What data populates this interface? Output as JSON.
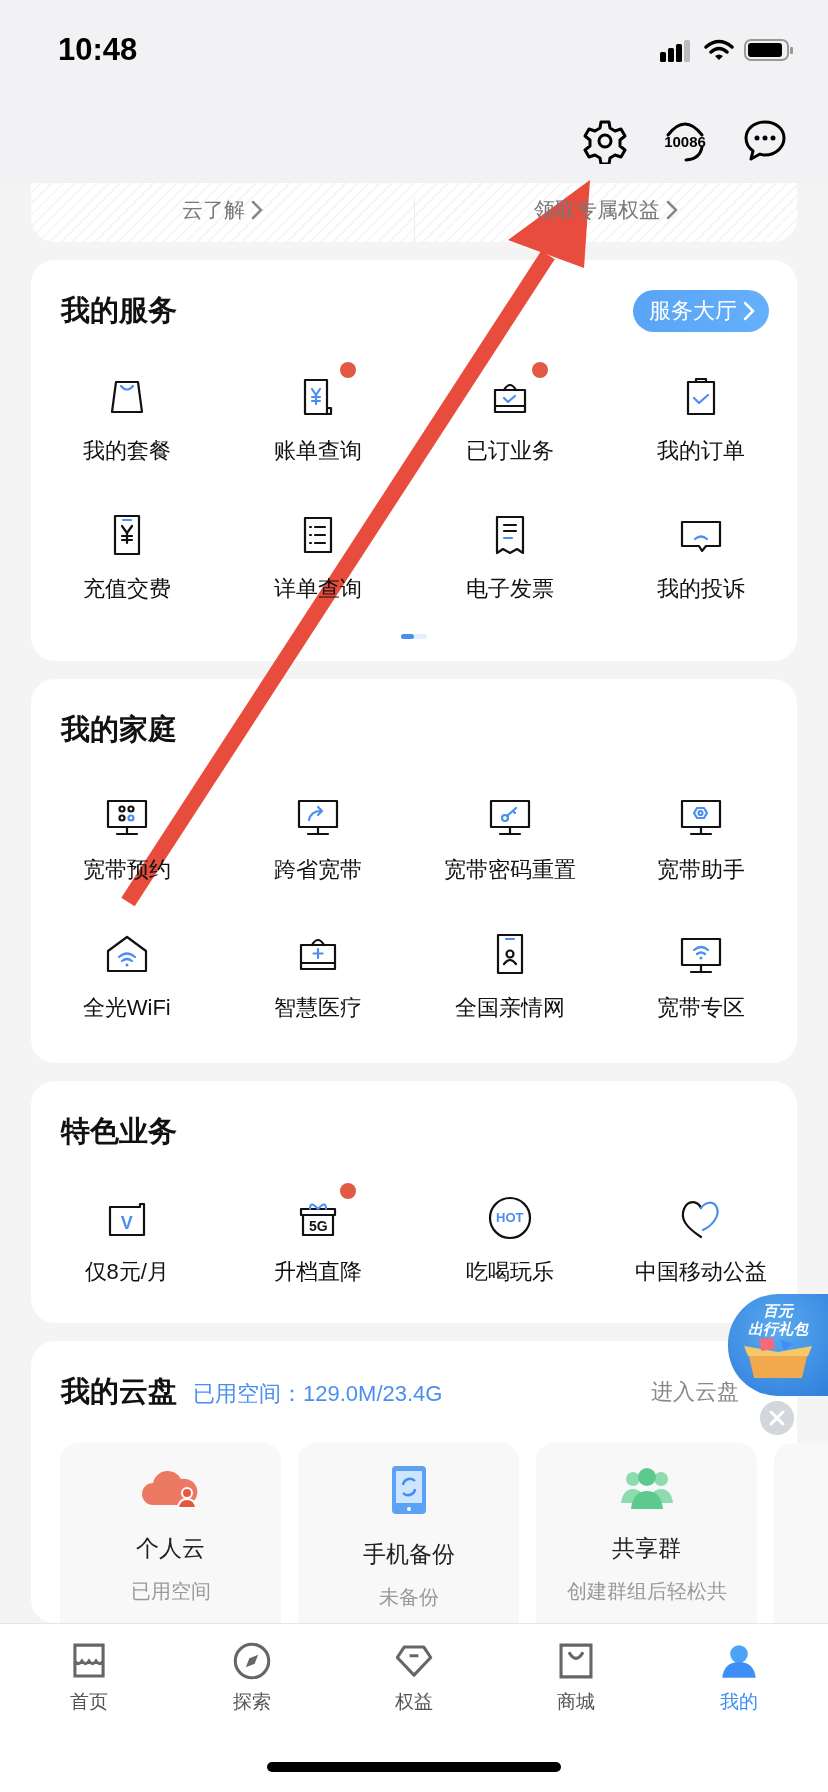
{
  "status_bar": {
    "time": "10:48"
  },
  "header": {
    "support_label": "10086"
  },
  "banner": {
    "items": [
      "云了解",
      "领取专属权益"
    ]
  },
  "services": {
    "title": "我的服务",
    "hall_button": "服务大厅",
    "items": [
      {
        "label": "我的套餐",
        "dot": false
      },
      {
        "label": "账单查询",
        "dot": true
      },
      {
        "label": "已订业务",
        "dot": true
      },
      {
        "label": "我的订单",
        "dot": false
      },
      {
        "label": "充值交费",
        "dot": false
      },
      {
        "label": "详单查询",
        "dot": false
      },
      {
        "label": "电子发票",
        "dot": false
      },
      {
        "label": "我的投诉",
        "dot": false
      }
    ]
  },
  "family": {
    "title": "我的家庭",
    "items": [
      {
        "label": "宽带预约"
      },
      {
        "label": "跨省宽带"
      },
      {
        "label": "宽带密码重置"
      },
      {
        "label": "宽带助手"
      },
      {
        "label": "全光WiFi"
      },
      {
        "label": "智慧医疗"
      },
      {
        "label": "全国亲情网"
      },
      {
        "label": "宽带专区"
      }
    ]
  },
  "features": {
    "title": "特色业务",
    "items": [
      {
        "label": "仅8元/月",
        "icon_text": "V",
        "dot": false
      },
      {
        "label": "升档直降",
        "icon_text": "5G",
        "dot": true
      },
      {
        "label": "吃喝玩乐",
        "icon_text": "HOT",
        "dot": false
      },
      {
        "label": "中国移动公益",
        "dot": false
      }
    ]
  },
  "cloud": {
    "title": "我的云盘",
    "usage": "已用空间：129.0M/23.4G",
    "enter_link": "进入云盘",
    "tiles": [
      {
        "title": "个人云",
        "subtitle": "已用空间"
      },
      {
        "title": "手机备份",
        "subtitle": "未备份"
      },
      {
        "title": "共享群",
        "subtitle": "创建群组后轻松共"
      }
    ]
  },
  "gift_badge": {
    "lines": [
      "百元",
      "出行礼包"
    ]
  },
  "tab_bar": [
    {
      "label": "首页",
      "selected": false
    },
    {
      "label": "探索",
      "selected": false
    },
    {
      "label": "权益",
      "selected": false
    },
    {
      "label": "商城",
      "selected": false
    },
    {
      "label": "我的",
      "selected": true
    }
  ]
}
